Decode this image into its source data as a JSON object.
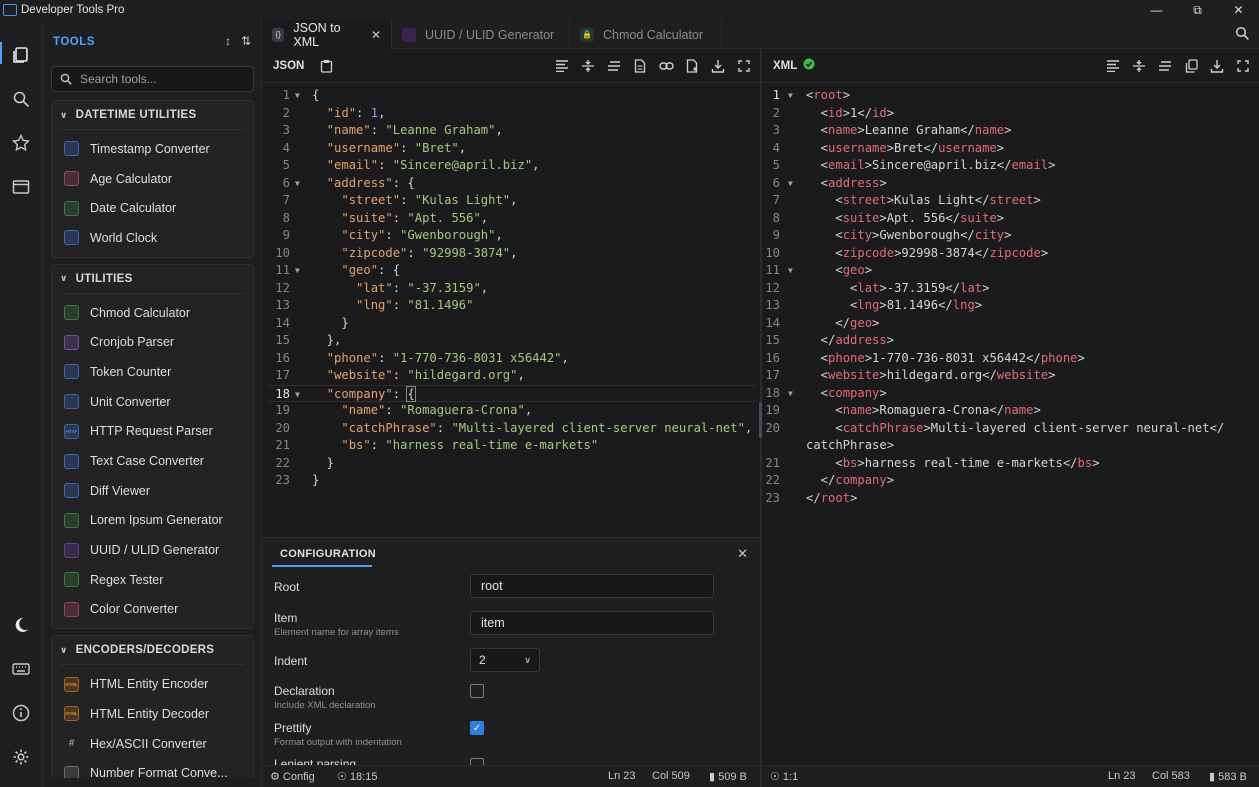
{
  "window": {
    "title": "Developer Tools Pro",
    "controls": [
      "minimize",
      "restore",
      "close"
    ]
  },
  "activity_bar": {
    "items": [
      "tools-icon",
      "search-icon",
      "star-icon",
      "window-icon",
      "moon-icon",
      "keyboard-icon",
      "info-icon",
      "gear-icon"
    ],
    "active": "tools-icon"
  },
  "sidebar": {
    "header": "TOOLS",
    "search_placeholder": "Search tools...",
    "sections": [
      {
        "title": "DATETIME UTILITIES",
        "items": [
          {
            "label": "Timestamp Converter",
            "icon": "clock-icon",
            "color": "#4e8cff"
          },
          {
            "label": "Age Calculator",
            "icon": "calendar-icon",
            "color": "#e05a7a"
          },
          {
            "label": "Date Calculator",
            "icon": "calendar-icon",
            "color": "#4caf50"
          },
          {
            "label": "World Clock",
            "icon": "globe-icon",
            "color": "#4e8cff"
          }
        ]
      },
      {
        "title": "UTILITIES",
        "items": [
          {
            "label": "Chmod Calculator",
            "icon": "lock-icon",
            "color": "#4caf50"
          },
          {
            "label": "Cronjob Parser",
            "icon": "clock-icon",
            "color": "#a070e0"
          },
          {
            "label": "Token Counter",
            "icon": "brackets-icon",
            "color": "#4e8cff"
          },
          {
            "label": "Unit Converter",
            "icon": "ruler-icon",
            "color": "#4e8cff"
          },
          {
            "label": "HTTP Request Parser",
            "icon": "http-icon",
            "color": "#4e8cff"
          },
          {
            "label": "Text Case Converter",
            "icon": "text-icon",
            "color": "#4e8cff"
          },
          {
            "label": "Diff Viewer",
            "icon": "file-diff-icon",
            "color": "#4e8cff"
          },
          {
            "label": "Lorem Ipsum Generator",
            "icon": "document-icon",
            "color": "#4caf50"
          },
          {
            "label": "UUID / ULID Generator",
            "icon": "fingerprint-icon",
            "color": "#8a4fd0"
          },
          {
            "label": "Regex Tester",
            "icon": "search-icon",
            "color": "#4caf50"
          },
          {
            "label": "Color Converter",
            "icon": "palette-icon",
            "color": "#e05a7a"
          }
        ]
      },
      {
        "title": "ENCODERS/DECODERS",
        "items": [
          {
            "label": "HTML Entity Encoder",
            "icon": "html-icon",
            "color": "#e08a2a"
          },
          {
            "label": "HTML Entity Decoder",
            "icon": "html-icon",
            "color": "#e08a2a"
          },
          {
            "label": "Hex/ASCII Converter",
            "icon": "hash-icon",
            "color": "#9a9aa0"
          },
          {
            "label": "Number Format Conve...",
            "icon": "number-icon",
            "color": "#9a9aa0"
          }
        ]
      }
    ]
  },
  "tabs": [
    {
      "label": "JSON to XML",
      "active": true,
      "icon": "braces-icon"
    },
    {
      "label": "UUID / ULID Generator",
      "active": false,
      "icon": "fingerprint-icon"
    },
    {
      "label": "Chmod Calculator",
      "active": false,
      "icon": "lock-icon"
    }
  ],
  "left_pane": {
    "label": "JSON",
    "cursor_line": 18,
    "lines": [
      "{",
      "  \"id\": 1,",
      "  \"name\": \"Leanne Graham\",",
      "  \"username\": \"Bret\",",
      "  \"email\": \"Sincere@april.biz\",",
      "  \"address\": {",
      "    \"street\": \"Kulas Light\",",
      "    \"suite\": \"Apt. 556\",",
      "    \"city\": \"Gwenborough\",",
      "    \"zipcode\": \"92998-3874\",",
      "    \"geo\": {",
      "      \"lat\": \"-37.3159\",",
      "      \"lng\": \"81.1496\"",
      "    }",
      "  },",
      "  \"phone\": \"1-770-736-8031 x56442\",",
      "  \"website\": \"hildegard.org\",",
      "  \"company\": {",
      "    \"name\": \"Romaguera-Crona\",",
      "    \"catchPhrase\": \"Multi-layered client-server neural-net\",",
      "    \"bs\": \"harness real-time e-markets\"",
      "  }",
      "}"
    ],
    "fold_lines": [
      1,
      6,
      11,
      18
    ]
  },
  "right_pane": {
    "label": "XML",
    "valid": true,
    "lines": [
      {
        "n": "1",
        "text": "<root>"
      },
      {
        "n": "2",
        "text": "  <id>1</id>"
      },
      {
        "n": "3",
        "text": "  <name>Leanne Graham</name>"
      },
      {
        "n": "4",
        "text": "  <username>Bret</username>"
      },
      {
        "n": "5",
        "text": "  <email>Sincere@april.biz</email>"
      },
      {
        "n": "6",
        "text": "  <address>"
      },
      {
        "n": "7",
        "text": "    <street>Kulas Light</street>"
      },
      {
        "n": "8",
        "text": "    <suite>Apt. 556</suite>"
      },
      {
        "n": "9",
        "text": "    <city>Gwenborough</city>"
      },
      {
        "n": "10",
        "text": "    <zipcode>92998-3874</zipcode>"
      },
      {
        "n": "11",
        "text": "    <geo>"
      },
      {
        "n": "12",
        "text": "      <lat>-37.3159</lat>"
      },
      {
        "n": "13",
        "text": "      <lng>81.1496</lng>"
      },
      {
        "n": "14",
        "text": "    </geo>"
      },
      {
        "n": "15",
        "text": "  </address>"
      },
      {
        "n": "16",
        "text": "  <phone>1-770-736-8031 x56442</phone>"
      },
      {
        "n": "17",
        "text": "  <website>hildegard.org</website>"
      },
      {
        "n": "18",
        "text": "  <company>"
      },
      {
        "n": "19",
        "text": "    <name>Romaguera-Crona</name>"
      },
      {
        "n": "20",
        "text": "    <catchPhrase>Multi-layered client-server neural-net</"
      },
      {
        "n": "",
        "text": "catchPhrase>"
      },
      {
        "n": "21",
        "text": "    <bs>harness real-time e-markets</bs>"
      },
      {
        "n": "22",
        "text": "  </company>"
      },
      {
        "n": "23",
        "text": "</root>"
      }
    ],
    "fold_lines": [
      "1",
      "6",
      "11",
      "18"
    ]
  },
  "configuration": {
    "header": "CONFIGURATION",
    "root_label": "Root",
    "root_value": "root",
    "item_label": "Item",
    "item_desc": "Element name for array items",
    "item_value": "item",
    "indent_label": "Indent",
    "indent_value": "2",
    "declaration_label": "Declaration",
    "declaration_desc": "Include XML declaration",
    "declaration_checked": false,
    "prettify_label": "Prettify",
    "prettify_desc": "Format output with indentation",
    "prettify_checked": true,
    "lenient_label": "Lenient parsing",
    "lenient_checked": false
  },
  "status_left": {
    "config": "Config",
    "time": "18:15",
    "ln": "Ln 23",
    "col": "Col 509",
    "size": "509 B"
  },
  "status_right": {
    "pos": "1:1",
    "ln": "Ln 23",
    "col": "Col 583",
    "size": "583 B"
  }
}
